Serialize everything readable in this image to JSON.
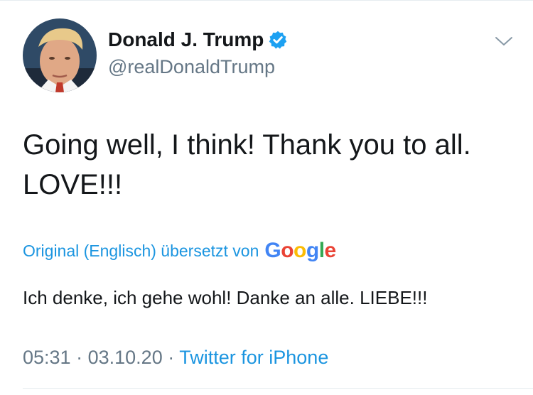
{
  "user": {
    "display_name": "Donald J. Trump",
    "handle": "@realDonaldTrump",
    "verified": true
  },
  "tweet": {
    "text_line1": "Going well, I think! Thank you to all.",
    "text_line2": "LOVE!!!"
  },
  "translation": {
    "label": "Original (Englisch) übersetzt von",
    "provider": [
      "G",
      "o",
      "o",
      "g",
      "l",
      "e"
    ],
    "provider_colors": [
      "#4285F4",
      "#EA4335",
      "#FBBC05",
      "#4285F4",
      "#34A853",
      "#EA4335"
    ],
    "text": "Ich denke, ich gehe wohl! Danke an alle. LIEBE!!!"
  },
  "meta": {
    "time": "05:31",
    "separator": "·",
    "date": "03.10.20",
    "source": "Twitter for iPhone"
  },
  "colors": {
    "link": "#1b95e0",
    "secondary_text": "#657786",
    "verified_badge": "#1da1f2"
  },
  "icons": {
    "verified": "verified-badge-icon",
    "menu": "chevron-down-icon"
  }
}
